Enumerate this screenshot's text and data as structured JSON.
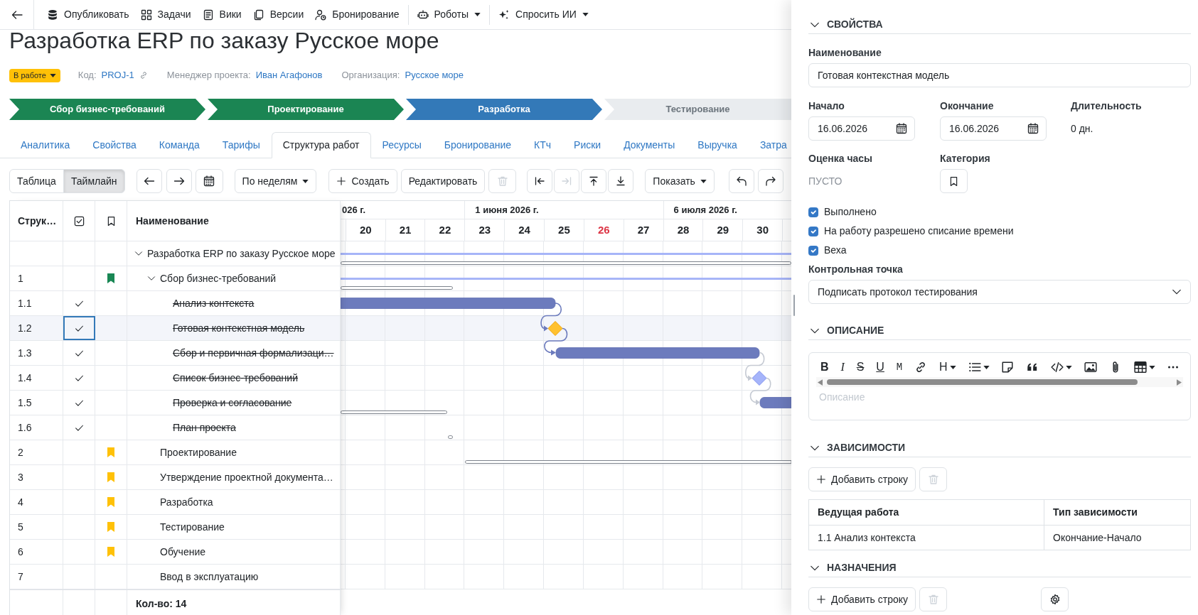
{
  "toolbar": {
    "groups": [
      [
        {
          "label": "Опубликовать",
          "dropdown": false
        },
        {
          "label": "Задачи",
          "dropdown": false
        },
        {
          "label": "Вики",
          "dropdown": false
        },
        {
          "label": "Версии",
          "dropdown": false
        },
        {
          "label": "Бронирование",
          "dropdown": false
        }
      ],
      [
        {
          "label": "Роботы",
          "dropdown": true
        }
      ],
      [
        {
          "label": "Спросить ИИ",
          "dropdown": true
        }
      ]
    ]
  },
  "project": {
    "title": "Разработка ERP по заказу Русское море",
    "status": "В работе",
    "meta": [
      {
        "label": "Код:",
        "value": "PROJ-1",
        "link_icon": true
      },
      {
        "label": "Менеджер проекта:",
        "value": "Иван Агафонов",
        "link_icon": false
      },
      {
        "label": "Организация:",
        "value": "Русское море",
        "link_icon": false
      }
    ]
  },
  "stages": [
    {
      "label": "Сбор бизнес-требований",
      "done": true
    },
    {
      "label": "Проектирование",
      "done": true
    },
    {
      "label": "Разработка",
      "done": false
    },
    {
      "label": "Тестирование",
      "done": false
    }
  ],
  "tabs": [
    {
      "label": "Аналитика",
      "selected": false
    },
    {
      "label": "Свойства",
      "selected": false
    },
    {
      "label": "Команда",
      "selected": false
    },
    {
      "label": "Тарифы",
      "selected": false
    },
    {
      "label": "Структура работ",
      "selected": true
    },
    {
      "label": "Ресурсы",
      "selected": false
    },
    {
      "label": "Бронирование",
      "selected": false
    },
    {
      "label": "КТч",
      "selected": false
    },
    {
      "label": "Риски",
      "selected": false
    },
    {
      "label": "Документы",
      "selected": false
    },
    {
      "label": "Выручка",
      "selected": false
    },
    {
      "label": "Затра",
      "selected": false
    }
  ],
  "actions": {
    "views": [
      {
        "label": "Таблица",
        "selected": false
      },
      {
        "label": "Таймлайн",
        "selected": true
      }
    ],
    "scale": "По неделям",
    "create": "Создать",
    "edit": "Редактировать",
    "delete": {
      "disabled": true
    },
    "move": [
      {
        "disabled": false
      },
      {
        "disabled": true
      },
      {
        "disabled": false
      },
      {
        "disabled": false
      }
    ],
    "show": "Показать"
  },
  "table": {
    "code_column": "Струк…",
    "name_column": "Наименование",
    "rows": [
      {
        "name": "Разработка ERP по заказу Русское море",
        "done": false,
        "selected": false,
        "expanded": true,
        "children": [
          {
            "code": "1",
            "name": "Сбор бизнес-требований",
            "done": false,
            "selected": false,
            "color": "#198754",
            "expanded": true,
            "children": [
              {
                "code": "1.1",
                "name": "Анализ контекста",
                "done": true,
                "selected": false
              },
              {
                "code": "1.2",
                "name": "Готовая контекстная модель",
                "done": true,
                "selected": true
              },
              {
                "code": "1.3",
                "name": "Сбор и первичная формализаци…",
                "done": true,
                "selected": false
              },
              {
                "code": "1.4",
                "name": "Список бизнес-требований",
                "done": true,
                "selected": false
              },
              {
                "code": "1.5",
                "name": "Проверка и согласование",
                "done": true,
                "selected": false
              },
              {
                "code": "1.6",
                "name": "План проекта",
                "done": true,
                "selected": false
              }
            ]
          },
          {
            "code": "2",
            "name": "Проектирование",
            "done": false,
            "selected": false,
            "color": "#ffc107"
          },
          {
            "code": "3",
            "name": "Утверждение проектной документа…",
            "done": false,
            "selected": false,
            "color": "#ffc107"
          },
          {
            "code": "4",
            "name": "Разработка",
            "done": false,
            "selected": false,
            "color": "#ffc107"
          },
          {
            "code": "5",
            "name": "Тестирование",
            "done": false,
            "selected": false,
            "color": "#ffc107"
          },
          {
            "code": "6",
            "name": "Обучение",
            "done": false,
            "selected": false,
            "color": "#ffc107"
          },
          {
            "code": "7",
            "name": "Ввод в эксплуатацию",
            "done": false,
            "selected": false
          }
        ]
      }
    ],
    "footer": "Кол-во: 14"
  },
  "timeline": {
    "months": [
      "026 г.",
      "1 июня 2026 г.",
      "6 июля 2026 г."
    ],
    "weeks": [
      {
        "label": "20",
        "current": false
      },
      {
        "label": "21",
        "current": false
      },
      {
        "label": "22",
        "current": false
      },
      {
        "label": "23",
        "current": false
      },
      {
        "label": "24",
        "current": false
      },
      {
        "label": "25",
        "current": false
      },
      {
        "label": "26",
        "current": true
      },
      {
        "label": "27",
        "current": false
      },
      {
        "label": "28",
        "current": false
      },
      {
        "label": "29",
        "current": false
      },
      {
        "label": "30",
        "current": false
      }
    ]
  },
  "details": {
    "sections": [
      {
        "kind": "properties",
        "title": "СВОЙСТВА",
        "expanded": true,
        "name": {
          "label": "Наименование",
          "value": "Готовая контекстная модель"
        },
        "start": {
          "label": "Начало",
          "value": "16.06.2026"
        },
        "end": {
          "label": "Окончание",
          "value": "16.06.2026"
        },
        "duration": {
          "label": "Длительность",
          "value": "0 дн."
        },
        "estimate": {
          "label": "Оценка часы",
          "value": "ПУСТО"
        },
        "category": {
          "label": "Категория"
        },
        "flags": [
          {
            "label": "Выполнено",
            "checked": true
          },
          {
            "label": "На работу разрешено списание времени",
            "checked": true
          },
          {
            "label": "Веха",
            "checked": true
          }
        ],
        "checkpoint": {
          "label": "Контрольная точка",
          "value": "Подписать протокол тестирования"
        }
      },
      {
        "kind": "description",
        "title": "ОПИСАНИЕ",
        "expanded": true,
        "toolbar": [
          {
            "kind": "bold",
            "label": "B",
            "dropdown": false
          },
          {
            "kind": "italic",
            "label": "I",
            "dropdown": false
          },
          {
            "kind": "strike",
            "label": "S",
            "dropdown": false
          },
          {
            "kind": "underline",
            "label": "U",
            "dropdown": false
          },
          {
            "kind": "mono",
            "label": "M",
            "dropdown": false
          },
          {
            "kind": "link",
            "dropdown": false
          },
          {
            "kind": "heading",
            "label": "H",
            "dropdown": true
          },
          {
            "kind": "list",
            "dropdown": true
          },
          {
            "kind": "note",
            "dropdown": false
          },
          {
            "kind": "quote",
            "dropdown": false
          },
          {
            "kind": "code",
            "dropdown": true
          },
          {
            "kind": "image",
            "dropdown": false
          },
          {
            "kind": "attach",
            "dropdown": false
          },
          {
            "kind": "table",
            "dropdown": true
          },
          {
            "kind": "more",
            "dropdown": false
          }
        ],
        "placeholder": "Описание"
      },
      {
        "kind": "dependencies",
        "title": "ЗАВИСИМОСТИ",
        "expanded": true,
        "add": "Добавить строку",
        "delete_disabled": true,
        "columns": [
          "Ведущая работа",
          "Тип зависимости"
        ],
        "rows": [
          [
            "1.1 Анализ контекста",
            "Окончание-Начало"
          ]
        ]
      },
      {
        "kind": "assignments",
        "title": "НАЗНАЧЕНИЯ",
        "expanded": true,
        "add": "Добавить строку",
        "delete_disabled": true
      }
    ]
  }
}
